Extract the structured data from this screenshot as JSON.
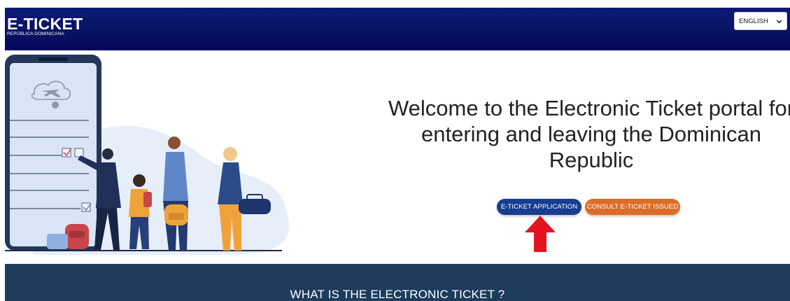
{
  "header": {
    "brand_title": "E-TICKET",
    "brand_subtitle": "REPÚBLICA DOMINICANA",
    "language_selected": "ENGLISH"
  },
  "hero": {
    "welcome_text": "Welcome to the Electronic Ticket portal for entering and leaving the Dominican Republic",
    "buttons": {
      "apply_label": "E-TICKET APPLICATION",
      "consult_label": "CONSULT E-TICKET ISSUED"
    }
  },
  "section": {
    "title": "WHAT IS THE ELECTRONIC TICKET ?"
  },
  "colors": {
    "header_bg": "#0a1566",
    "apply_button": "#163d8f",
    "consult_button": "#dc6d27",
    "footer_band": "#1d3c5e",
    "annotation_arrow": "#e3141f"
  },
  "icons": [
    "chevron-down-icon",
    "airplane-cloud-icon",
    "red-arrow-up-icon"
  ]
}
